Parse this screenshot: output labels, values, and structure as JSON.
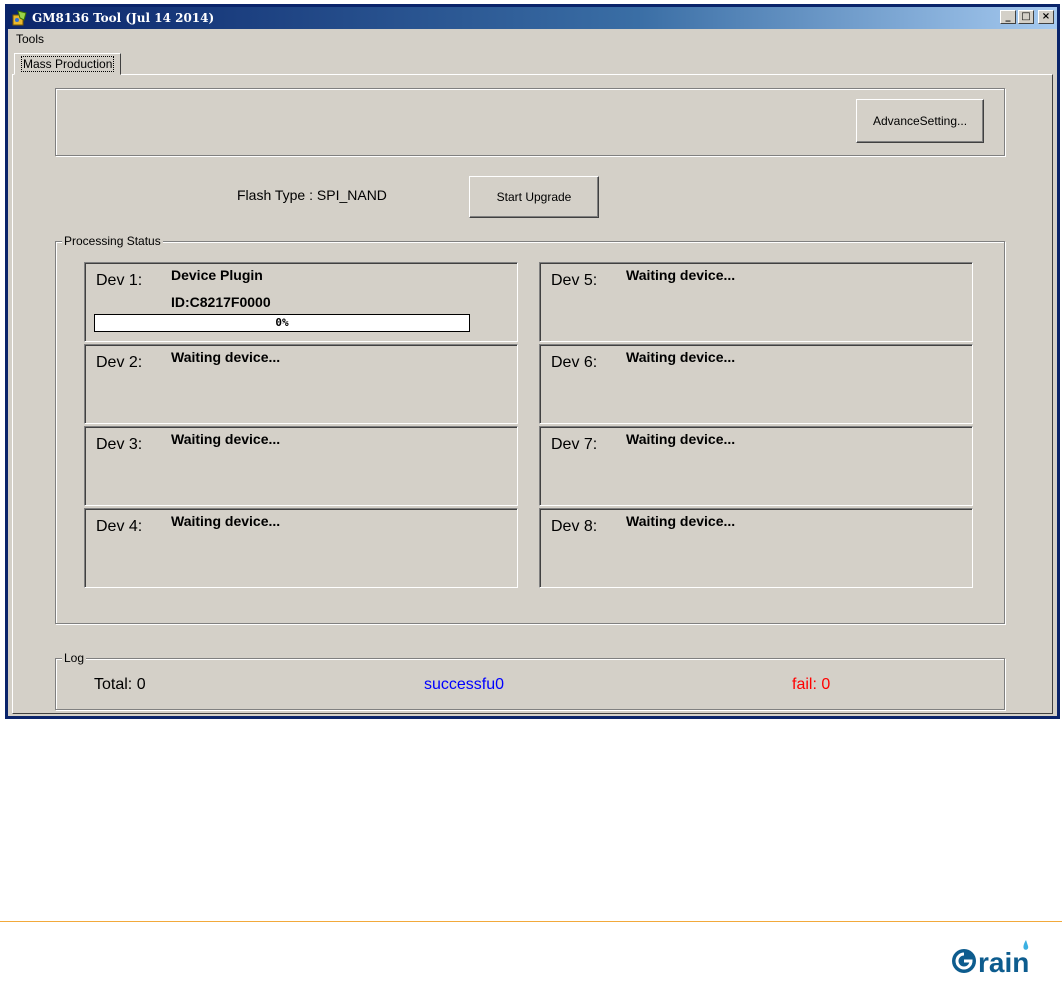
{
  "window": {
    "title": "GM8136 Tool (Jul 14 2014)",
    "controls": {
      "minimize": "_",
      "maximize": "□",
      "close": "×"
    }
  },
  "menu": {
    "items": [
      "Tools"
    ]
  },
  "tabs": [
    "Mass Production"
  ],
  "settings": {
    "advance_label": "AdvanceSetting..."
  },
  "flash": {
    "label": "Flash Type : SPI_NAND"
  },
  "actions": {
    "start_label": "Start Upgrade"
  },
  "processing": {
    "title": "Processing Status",
    "devices": [
      {
        "label": "Dev 1:",
        "status": "Device Plugin",
        "id": "ID:C8217F0000",
        "progress": 0,
        "progress_text": "0%"
      },
      {
        "label": "Dev 2:",
        "status": "Waiting device..."
      },
      {
        "label": "Dev 3:",
        "status": "Waiting device..."
      },
      {
        "label": "Dev 4:",
        "status": "Waiting device..."
      },
      {
        "label": "Dev 5:",
        "status": "Waiting device..."
      },
      {
        "label": "Dev 6:",
        "status": "Waiting device..."
      },
      {
        "label": "Dev 7:",
        "status": "Waiting device..."
      },
      {
        "label": "Dev 8:",
        "status": "Waiting device..."
      }
    ]
  },
  "log": {
    "title": "Log",
    "total": "Total:  0",
    "success": "successfu0",
    "fail": "fail:   0",
    "colors": {
      "success": "#0000ff",
      "fail": "#ff0000"
    }
  },
  "branding": {
    "logo": "rain",
    "logo_color": "#0d5c8e",
    "accent_rule_color": "#f2a93b"
  }
}
